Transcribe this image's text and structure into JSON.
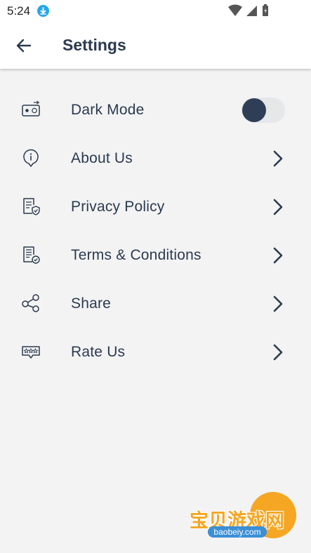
{
  "status_bar": {
    "time": "5:24"
  },
  "header": {
    "title": "Settings"
  },
  "settings": {
    "items": [
      {
        "label": "Dark Mode",
        "icon": "dark-mode-icon",
        "control": "toggle",
        "value": false
      },
      {
        "label": "About Us",
        "icon": "info-icon",
        "control": "chevron"
      },
      {
        "label": "Privacy Policy",
        "icon": "privacy-document-icon",
        "control": "chevron"
      },
      {
        "label": "Terms & Conditions",
        "icon": "terms-document-icon",
        "control": "chevron"
      },
      {
        "label": "Share",
        "icon": "share-icon",
        "control": "chevron"
      },
      {
        "label": "Rate Us",
        "icon": "rate-stars-icon",
        "control": "chevron"
      }
    ]
  },
  "watermark": {
    "brand": "宝贝游戏网",
    "url": "baobeiy.com"
  },
  "colors": {
    "text": "#2b3a4f",
    "background": "#f3f3f4",
    "toggle_knob": "#2d3e56",
    "status_download": "#29a6e8"
  }
}
